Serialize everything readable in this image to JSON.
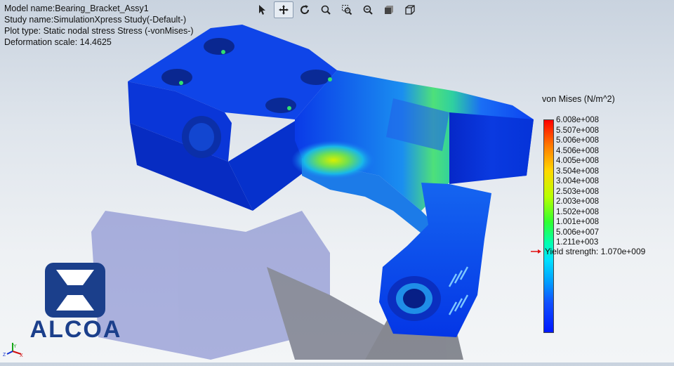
{
  "info": {
    "model_name": "Model name:Bearing_Bracket_Assy1",
    "study_name": "Study name:SimulationXpress Study(-Default-)",
    "plot_type": "Plot type: Static nodal stress Stress (-vonMises-)",
    "deformation": "Deformation scale: 14.4625"
  },
  "toolbar": [
    {
      "icon": "select-arrow-icon"
    },
    {
      "icon": "pan-icon",
      "active": true
    },
    {
      "icon": "rotate-icon"
    },
    {
      "icon": "zoom-in-out-icon"
    },
    {
      "icon": "zoom-to-area-icon"
    },
    {
      "icon": "zoom-to-fit-icon"
    },
    {
      "icon": "view-orientation-icon"
    },
    {
      "icon": "display-style-icon"
    }
  ],
  "legend": {
    "title": "von Mises (N/m^2)",
    "values": [
      "6.008e+008",
      "5.507e+008",
      "5.006e+008",
      "4.506e+008",
      "4.005e+008",
      "3.504e+008",
      "3.004e+008",
      "2.503e+008",
      "2.003e+008",
      "1.502e+008",
      "1.001e+008",
      "5.006e+007",
      "1.211e+003"
    ],
    "yield": "Yield strength: 1.070e+009"
  },
  "logo": {
    "text": "ALCOA",
    "color": "#1b3f8b"
  },
  "triad": {
    "x": "X",
    "y": "Y",
    "z": "Z"
  },
  "model_engraving": "ALCOA"
}
